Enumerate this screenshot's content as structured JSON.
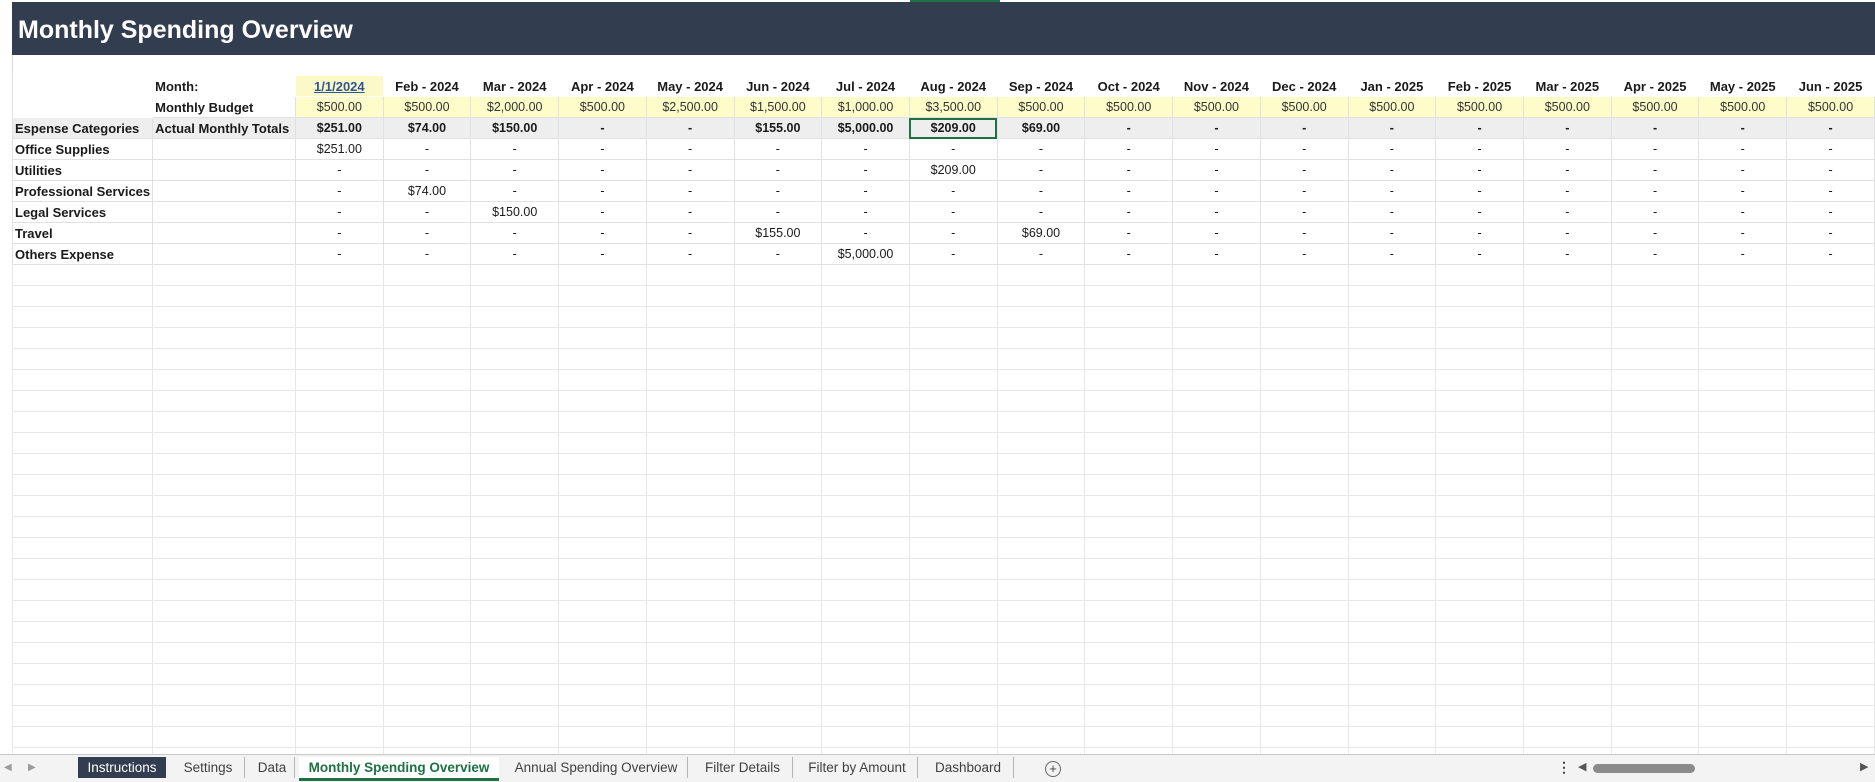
{
  "title": "Monthly Spending Overview",
  "labels": {
    "month": "Month:",
    "budget": "Monthly Budget",
    "categories_header": "Espense Categories",
    "totals_header": "Actual Monthly Totals"
  },
  "months": [
    "1/1/2024",
    "Feb - 2024",
    "Mar - 2024",
    "Apr - 2024",
    "May - 2024",
    "Jun - 2024",
    "Jul - 2024",
    "Aug - 2024",
    "Sep - 2024",
    "Oct - 2024",
    "Nov - 2024",
    "Dec - 2024",
    "Jan - 2025",
    "Feb - 2025",
    "Mar - 2025",
    "Apr - 2025",
    "May - 2025",
    "Jun - 2025"
  ],
  "budgets": [
    "$500.00",
    "$500.00",
    "$2,000.00",
    "$500.00",
    "$2,500.00",
    "$1,500.00",
    "$1,000.00",
    "$3,500.00",
    "$500.00",
    "$500.00",
    "$500.00",
    "$500.00",
    "$500.00",
    "$500.00",
    "$500.00",
    "$500.00",
    "$500.00",
    "$500.00"
  ],
  "totals": [
    "$251.00",
    "$74.00",
    "$150.00",
    "-",
    "-",
    "$155.00",
    "$5,000.00",
    "$209.00",
    "$69.00",
    "-",
    "-",
    "-",
    "-",
    "-",
    "-",
    "-",
    "-",
    "-"
  ],
  "categories": [
    {
      "name": "Office Supplies",
      "values": [
        "$251.00",
        "-",
        "-",
        "-",
        "-",
        "-",
        "-",
        "-",
        "-",
        "-",
        "-",
        "-",
        "-",
        "-",
        "-",
        "-",
        "-",
        "-"
      ]
    },
    {
      "name": "Utilities",
      "values": [
        "-",
        "-",
        "-",
        "-",
        "-",
        "-",
        "-",
        "$209.00",
        "-",
        "-",
        "-",
        "-",
        "-",
        "-",
        "-",
        "-",
        "-",
        "-"
      ]
    },
    {
      "name": "Professional Services",
      "values": [
        "-",
        "$74.00",
        "-",
        "-",
        "-",
        "-",
        "-",
        "-",
        "-",
        "-",
        "-",
        "-",
        "-",
        "-",
        "-",
        "-",
        "-",
        "-"
      ]
    },
    {
      "name": "Legal Services",
      "values": [
        "-",
        "-",
        "$150.00",
        "-",
        "-",
        "-",
        "-",
        "-",
        "-",
        "-",
        "-",
        "-",
        "-",
        "-",
        "-",
        "-",
        "-",
        "-"
      ]
    },
    {
      "name": "Travel",
      "values": [
        "-",
        "-",
        "-",
        "-",
        "-",
        "$155.00",
        "-",
        "-",
        "$69.00",
        "-",
        "-",
        "-",
        "-",
        "-",
        "-",
        "-",
        "-",
        "-"
      ]
    },
    {
      "name": "Others Expense",
      "values": [
        "-",
        "-",
        "-",
        "-",
        "-",
        "-",
        "$5,000.00",
        "-",
        "-",
        "-",
        "-",
        "-",
        "-",
        "-",
        "-",
        "-",
        "-",
        "-"
      ]
    }
  ],
  "selected_cell": "Aug - 2024 / Actual Monthly Totals",
  "tabs": [
    {
      "label": "Instructions",
      "style": "dark"
    },
    {
      "label": "Settings",
      "style": "normal"
    },
    {
      "label": "Data",
      "style": "normal"
    },
    {
      "label": "Monthly Spending Overview",
      "style": "active"
    },
    {
      "label": "Annual Spending Overview",
      "style": "normal"
    },
    {
      "label": "Filter Details",
      "style": "normal"
    },
    {
      "label": "Filter by Amount",
      "style": "normal"
    },
    {
      "label": "Dashboard",
      "style": "normal"
    }
  ],
  "colors": {
    "banner": "#323d4f",
    "budget_fill": "#fefcc8",
    "totals_fill": "#eeeeee",
    "accent_green": "#1e7145",
    "month_link": "#2f5597"
  },
  "icons": {
    "add_sheet": "plus-circle-icon",
    "more": "vertical-dots-icon",
    "scroll_left": "triangle-left-icon",
    "scroll_right": "triangle-right-icon"
  }
}
